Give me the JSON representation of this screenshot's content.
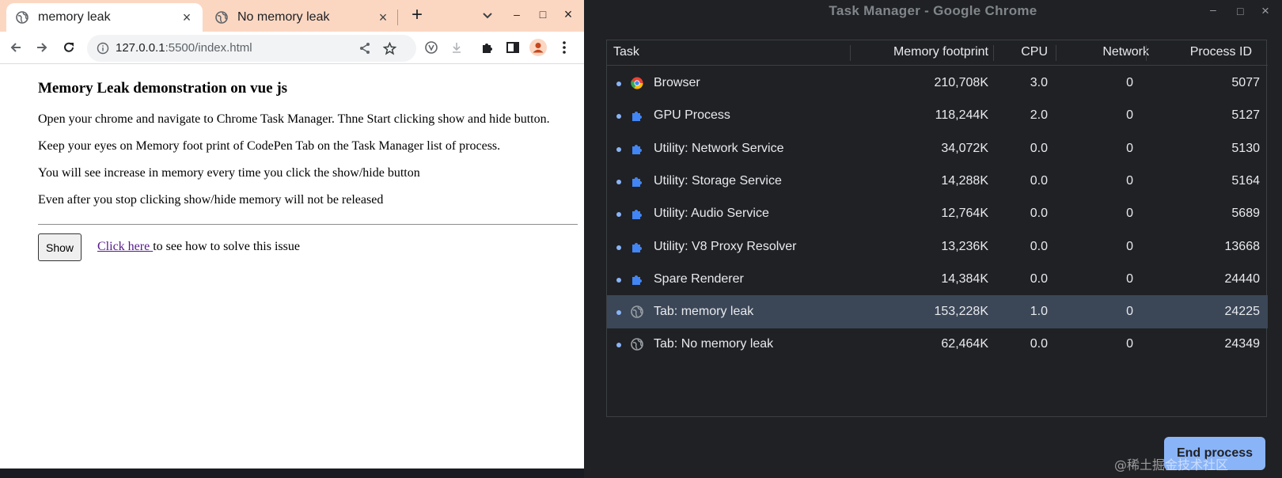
{
  "browser": {
    "tabs": [
      {
        "title": "memory leak",
        "active": true
      },
      {
        "title": "No memory leak",
        "active": false
      }
    ],
    "new_tab_label": "+",
    "url_host": "127.0.0.1",
    "url_rest": ":5500/index.html",
    "page": {
      "heading": "Memory Leak demonstration on vue js",
      "paragraphs": [
        "Open your chrome and navigate to Chrome Task Manager. Thne Start clicking show and hide button.",
        "Keep your eyes on Memory foot print of CodePen Tab on the Task Manager list of process.",
        "You will see increase in memory every time you click the show/hide button",
        "Even after you stop clicking show/hide memory will not be released"
      ],
      "show_button": "Show",
      "link_text": "Click here ",
      "link_suffix": "to see how to solve this issue"
    }
  },
  "task_manager": {
    "title": "Task Manager - Google Chrome",
    "columns": {
      "task": "Task",
      "memory": "Memory footprint",
      "cpu": "CPU",
      "network": "Network",
      "pid": "Process ID"
    },
    "rows": [
      {
        "task": "Browser",
        "memory": "210,708K",
        "cpu": "3.0",
        "network": "0",
        "pid": "5077",
        "icon": "chrome-icon"
      },
      {
        "task": "GPU Process",
        "memory": "118,244K",
        "cpu": "2.0",
        "network": "0",
        "pid": "5127",
        "icon": "puzzle-icon"
      },
      {
        "task": "Utility: Network Service",
        "memory": "34,072K",
        "cpu": "0.0",
        "network": "0",
        "pid": "5130",
        "icon": "puzzle-icon"
      },
      {
        "task": "Utility: Storage Service",
        "memory": "14,288K",
        "cpu": "0.0",
        "network": "0",
        "pid": "5164",
        "icon": "puzzle-icon"
      },
      {
        "task": "Utility: Audio Service",
        "memory": "12,764K",
        "cpu": "0.0",
        "network": "0",
        "pid": "5689",
        "icon": "puzzle-icon"
      },
      {
        "task": "Utility: V8 Proxy Resolver",
        "memory": "13,236K",
        "cpu": "0.0",
        "network": "0",
        "pid": "13668",
        "icon": "puzzle-icon"
      },
      {
        "task": "Spare Renderer",
        "memory": "14,384K",
        "cpu": "0.0",
        "network": "0",
        "pid": "24440",
        "icon": "puzzle-icon"
      },
      {
        "task": "Tab: memory leak",
        "memory": "153,228K",
        "cpu": "1.0",
        "network": "0",
        "pid": "24225",
        "icon": "globe-icon",
        "selected": true
      },
      {
        "task": "Tab: No memory leak",
        "memory": "62,464K",
        "cpu": "0.0",
        "network": "0",
        "pid": "24349",
        "icon": "globe-icon"
      }
    ],
    "end_process_label": "End process",
    "watermark": "@稀土掘金技术社区"
  },
  "colors": {
    "tabstrip": "#fbd7c2",
    "taskmgr_bg": "#202124",
    "selected_row": "#3b4657",
    "accent": "#8ab4f8",
    "link": "#551a8b"
  }
}
